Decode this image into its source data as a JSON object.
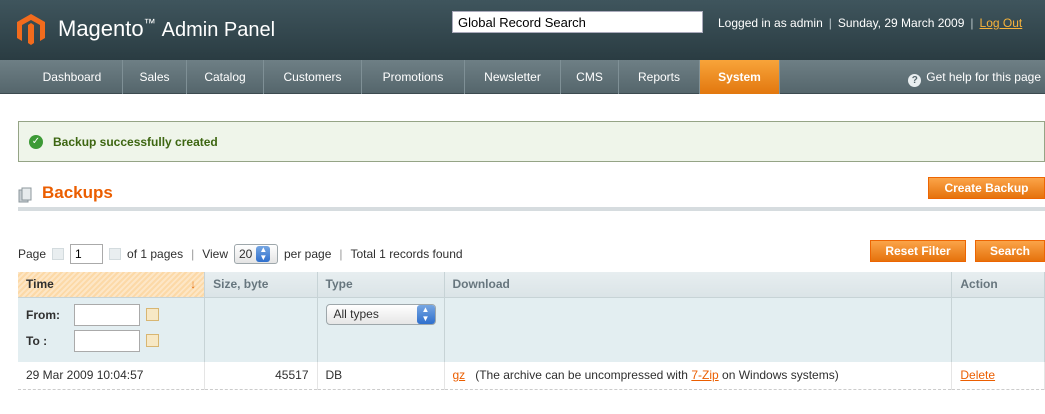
{
  "header": {
    "app_name": "Magento",
    "app_suffix": "Admin Panel",
    "search_value": "Global Record Search",
    "logged_in": "Logged in as admin",
    "date": "Sunday, 29 March 2009",
    "logout": "Log Out"
  },
  "nav": {
    "items": [
      {
        "label": "Dashboard"
      },
      {
        "label": "Sales"
      },
      {
        "label": "Catalog"
      },
      {
        "label": "Customers"
      },
      {
        "label": "Promotions"
      },
      {
        "label": "Newsletter"
      },
      {
        "label": "CMS"
      },
      {
        "label": "Reports"
      },
      {
        "label": "System"
      }
    ],
    "active": "System",
    "help": "Get help for this page"
  },
  "message": {
    "text": "Backup successfully created"
  },
  "page": {
    "title": "Backups",
    "create_button": "Create Backup"
  },
  "pager": {
    "page_label": "Page",
    "page_value": "1",
    "of_pages": "of 1 pages",
    "view_label": "View",
    "per_page_value": "20",
    "per_page_label": "per page",
    "total": "Total 1 records found",
    "reset_filter": "Reset Filter",
    "search": "Search"
  },
  "grid": {
    "columns": [
      "Time",
      "Size, byte",
      "Type",
      "Download",
      "Action"
    ],
    "filters": {
      "from_label": "From:",
      "to_label": "To :",
      "type_value": "All types"
    },
    "rows": [
      {
        "time": "29 Mar 2009 10:04:57",
        "size": "45517",
        "type": "DB",
        "download_link": "gz",
        "download_note_pre": "(The archive can be uncompressed with",
        "download_note_link": "7-Zip",
        "download_note_post": "on Windows systems)",
        "action": "Delete"
      }
    ]
  },
  "colors": {
    "accent": "#eb5e00",
    "header_bg": "#2f4248",
    "nav_active": "#f08b1f",
    "success_bg": "#eff5ea"
  }
}
